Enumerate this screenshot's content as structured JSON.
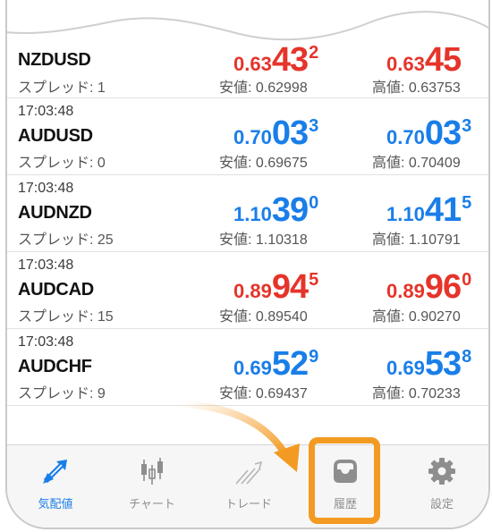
{
  "quotes": [
    {
      "time": "",
      "symbol": "NZDUSD",
      "spread": "スプレッド: 1",
      "bid": {
        "small": "0.63",
        "big": "43",
        "sup": "2",
        "color": "red"
      },
      "ask": {
        "small": "0.63",
        "big": "45",
        "sup": "",
        "color": "red"
      },
      "low": "安値: 0.62998",
      "high": "高値: 0.63753"
    },
    {
      "time": "17:03:48",
      "symbol": "AUDUSD",
      "spread": "スプレッド: 0",
      "bid": {
        "small": "0.70",
        "big": "03",
        "sup": "3",
        "color": "blue"
      },
      "ask": {
        "small": "0.70",
        "big": "03",
        "sup": "3",
        "color": "blue"
      },
      "low": "安値: 0.69675",
      "high": "高値: 0.70409"
    },
    {
      "time": "17:03:48",
      "symbol": "AUDNZD",
      "spread": "スプレッド: 25",
      "bid": {
        "small": "1.10",
        "big": "39",
        "sup": "0",
        "color": "blue"
      },
      "ask": {
        "small": "1.10",
        "big": "41",
        "sup": "5",
        "color": "blue"
      },
      "low": "安値: 1.10318",
      "high": "高値: 1.10791"
    },
    {
      "time": "17:03:48",
      "symbol": "AUDCAD",
      "spread": "スプレッド: 15",
      "bid": {
        "small": "0.89",
        "big": "94",
        "sup": "5",
        "color": "red"
      },
      "ask": {
        "small": "0.89",
        "big": "96",
        "sup": "0",
        "color": "red"
      },
      "low": "安値: 0.89540",
      "high": "高値: 0.90270"
    },
    {
      "time": "17:03:48",
      "symbol": "AUDCHF",
      "spread": "スプレッド: 9",
      "bid": {
        "small": "0.69",
        "big": "52",
        "sup": "9",
        "color": "blue"
      },
      "ask": {
        "small": "0.69",
        "big": "53",
        "sup": "8",
        "color": "blue"
      },
      "low": "安値: 0.69437",
      "high": "高値: 0.70233"
    }
  ],
  "tabs": [
    {
      "label": "気配値",
      "icon": "quotes-arrows-icon",
      "active": true
    },
    {
      "label": "チャート",
      "icon": "candlestick-chart-icon",
      "active": false
    },
    {
      "label": "トレード",
      "icon": "trade-line-icon",
      "active": false
    },
    {
      "label": "履歴",
      "icon": "inbox-tray-icon",
      "active": false
    },
    {
      "label": "設定",
      "icon": "gear-icon",
      "active": false
    }
  ],
  "colors": {
    "blue": "#1a7ee8",
    "red": "#e5342a",
    "highlight": "#f39a22",
    "tab_gray": "#8e8e8e"
  }
}
